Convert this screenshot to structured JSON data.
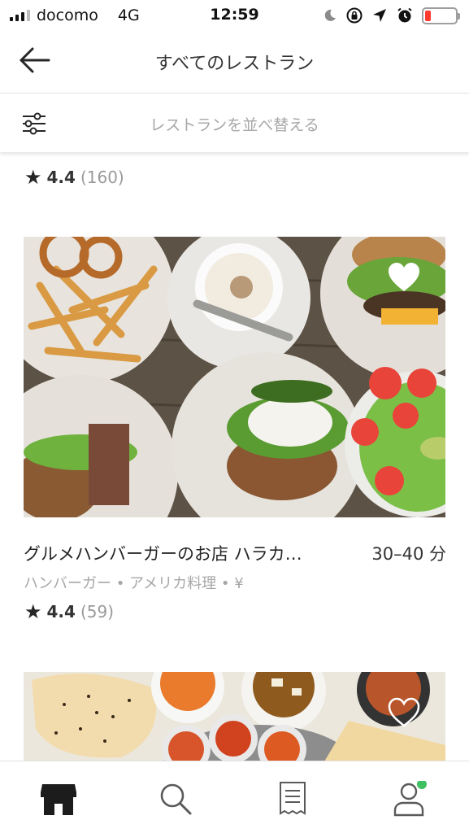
{
  "status_bar": {
    "carrier": "docomo",
    "network": "4G",
    "time": "12:59",
    "battery_level": 0.2
  },
  "header": {
    "title": "すべてのレストラン",
    "back_icon": "arrow-left-icon"
  },
  "sort": {
    "label": "レストランを並べ替える",
    "icon": "filter-sliders-icon"
  },
  "previous_restaurant": {
    "rating": "4.4",
    "rating_count": "(160)"
  },
  "restaurants": [
    {
      "name": "グルメハンバーガーのお店 ハラカ…",
      "delivery_time": "30–40 分",
      "categories": "ハンバーガー • アメリカ料理 • ¥",
      "rating": "4.4",
      "rating_count": "(59)",
      "favorited": true
    },
    {
      "favorited": false
    }
  ],
  "tab_bar": {
    "tabs": [
      {
        "icon": "storefront-icon",
        "active": true
      },
      {
        "icon": "search-icon",
        "active": false
      },
      {
        "icon": "receipt-icon",
        "active": false
      },
      {
        "icon": "account-icon",
        "active": false,
        "badge_color": "#3fc060"
      }
    ]
  }
}
